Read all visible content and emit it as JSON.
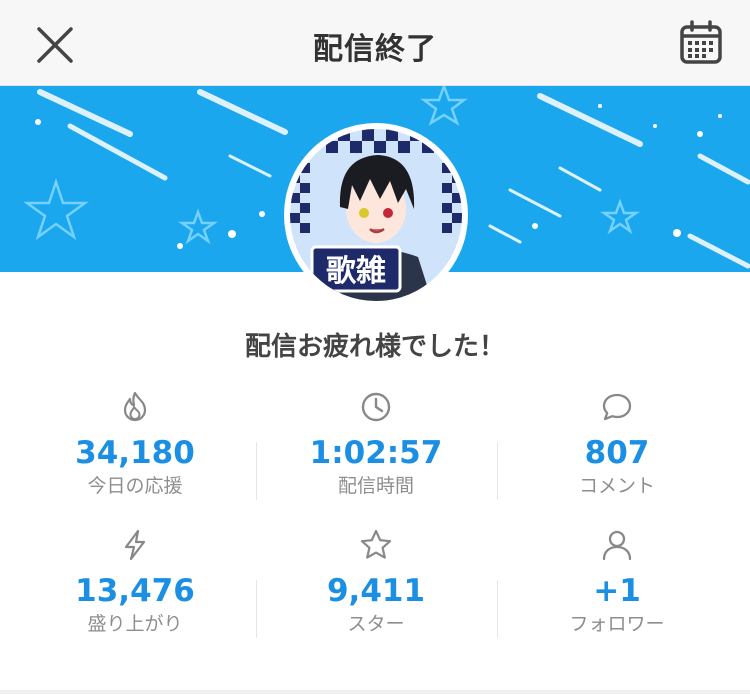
{
  "header": {
    "title": "配信終了",
    "close_icon": "close-icon",
    "calendar_icon": "calendar-icon"
  },
  "banner": {
    "color": "#1aa7ee"
  },
  "avatar": {
    "badge_text": "歌雑"
  },
  "message": "配信お疲れ様でした！",
  "stats": [
    {
      "icon": "fire-icon",
      "value": "34,180",
      "label": "今日の応援"
    },
    {
      "icon": "clock-icon",
      "value": "1:02:57",
      "label": "配信時間"
    },
    {
      "icon": "comment-icon",
      "value": "807",
      "label": "コメント"
    },
    {
      "icon": "lightning-icon",
      "value": "13,476",
      "label": "盛り上がり"
    },
    {
      "icon": "star-icon",
      "value": "9,411",
      "label": "スター"
    },
    {
      "icon": "user-icon",
      "value": "+1",
      "label": "フォロワー"
    }
  ],
  "colors": {
    "value": "#1a8fe3",
    "label": "#8e8e8e"
  }
}
